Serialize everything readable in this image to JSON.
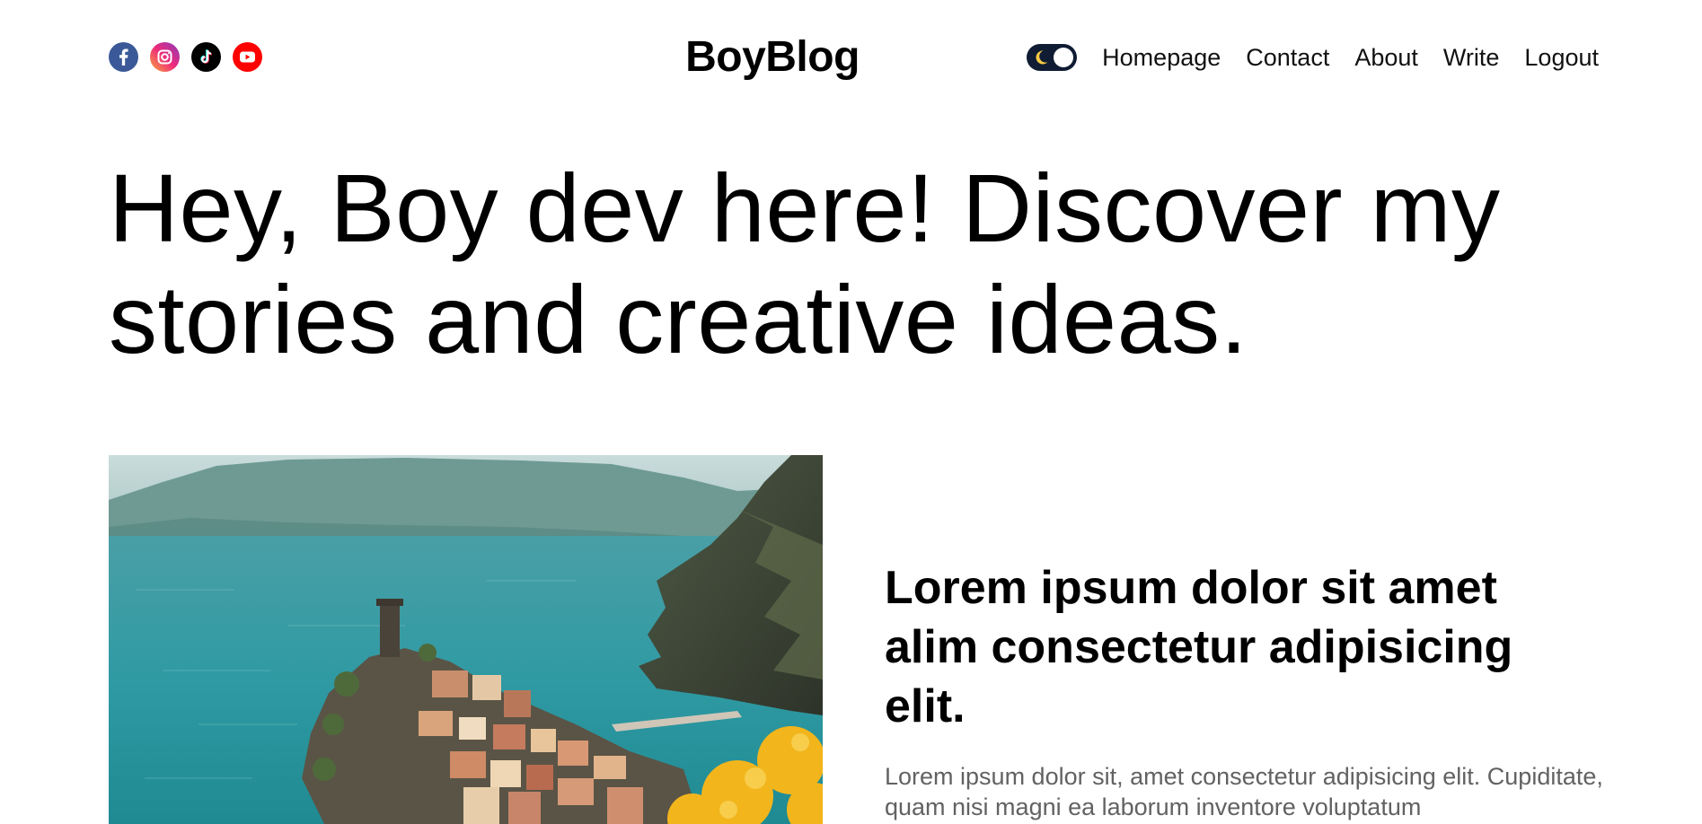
{
  "navbar": {
    "socials": [
      {
        "name": "facebook-icon",
        "color": "#3b5998"
      },
      {
        "name": "instagram-icon",
        "color": "#e1306c"
      },
      {
        "name": "tiktok-icon",
        "color": "#000000"
      },
      {
        "name": "youtube-icon",
        "color": "#ff0000"
      }
    ],
    "logo": "BoyBlog",
    "theme_toggle": {
      "icon": "moon-icon",
      "mode": "dark"
    },
    "links": {
      "homepage": "Homepage",
      "contact": "Contact",
      "about": "About",
      "write": "Write",
      "logout": "Logout"
    }
  },
  "hero": {
    "greeting": "Hey, Boy dev here!",
    "tagline": "Discover my stories and creative ideas."
  },
  "featured_post": {
    "image": "coastal-village-landscape",
    "title": "Lorem ipsum dolor sit amet alim consectetur adipisicing elit.",
    "description": "Lorem ipsum dolor sit, amet consectetur adipisicing elit. Cupiditate, quam nisi magni ea laborum inventore voluptatum"
  },
  "colors": {
    "text": "#000000",
    "muted": "#626262",
    "toggle_bg": "#0f1c33",
    "moon": "#f6c944"
  }
}
